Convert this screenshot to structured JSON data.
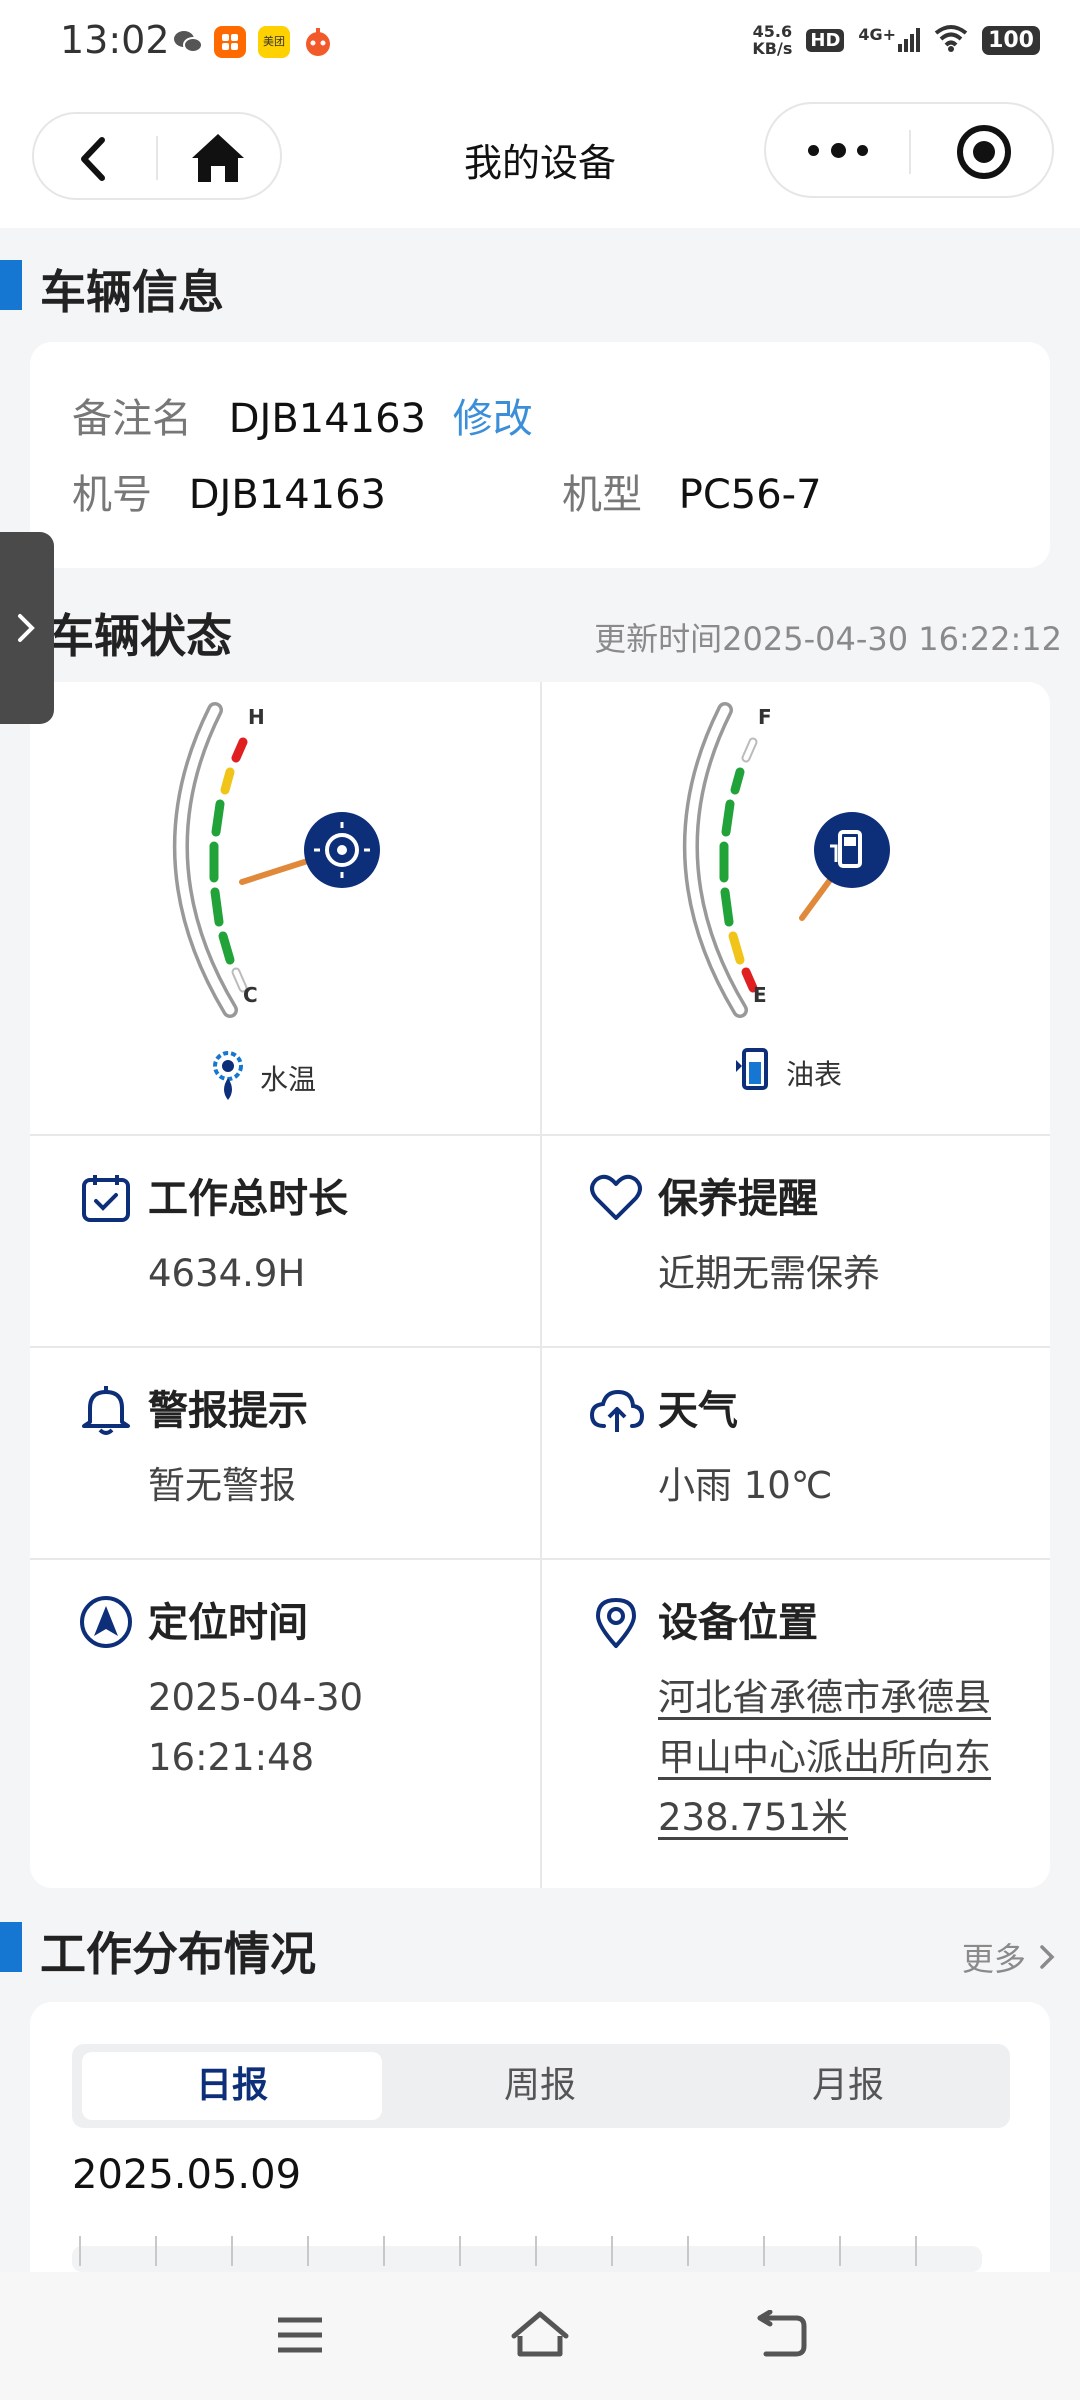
{
  "status_bar": {
    "time": "13:02",
    "speed_value": "45.6",
    "speed_unit": "KB/s",
    "hd_label": "HD",
    "network_label": "4G+",
    "battery": "100",
    "app_icons": [
      "wechat-icon",
      "taobao-icon",
      "meituan-icon",
      "game-icon"
    ],
    "meituan_text": "美团"
  },
  "titlebar": {
    "title": "我的设备",
    "back_icon": "chevron-left-icon",
    "home_icon": "home-icon",
    "more_icon": "more-dots-icon",
    "close_icon": "target-circle-icon"
  },
  "vehicle_info": {
    "heading": "车辆信息",
    "remark_label": "备注名",
    "remark_value": "DJB14163",
    "edit_label": "修改",
    "machine_no_label": "机号",
    "machine_no_value": "DJB14163",
    "model_label": "机型",
    "model_value": "PC56-7"
  },
  "vehicle_status": {
    "heading": "车辆状态",
    "update_time": "更新时间2025-04-30 16:22:12",
    "water_temp": {
      "label": "水温",
      "high_mark": "H",
      "low_mark": "C",
      "needle_level": 0.35
    },
    "fuel": {
      "label": "油表",
      "full_mark": "F",
      "empty_mark": "E",
      "needle_level": 0.3
    },
    "cells": {
      "work_hours": {
        "title": "工作总时长",
        "value": "4634.9H"
      },
      "maintenance": {
        "title": "保养提醒",
        "value": "近期无需保养"
      },
      "alarm": {
        "title": "警报提示",
        "value": "暂无警报"
      },
      "weather": {
        "title": "天气",
        "value": "小雨 10℃"
      },
      "locate_time": {
        "title": "定位时间",
        "date": "2025-04-30",
        "time": "16:21:48"
      },
      "location": {
        "title": "设备位置",
        "line1": "河北省承德市承德县",
        "line2": "甲山中心派出所向东",
        "line3": "238.751米"
      }
    }
  },
  "work_distribution": {
    "heading": "工作分布情况",
    "more": "更多",
    "tabs": [
      "日报",
      "周报",
      "月报"
    ],
    "active_tab": "日报",
    "date": "2025.05.09"
  },
  "colors": {
    "accent_blue": "#1677d2",
    "edit_link": "#3b8fd9",
    "icon_navy": "#0d2f7a",
    "gauge_red": "#e02020",
    "gauge_yellow": "#f0c419",
    "gauge_green": "#22a33a",
    "needle": "#e0893a"
  }
}
